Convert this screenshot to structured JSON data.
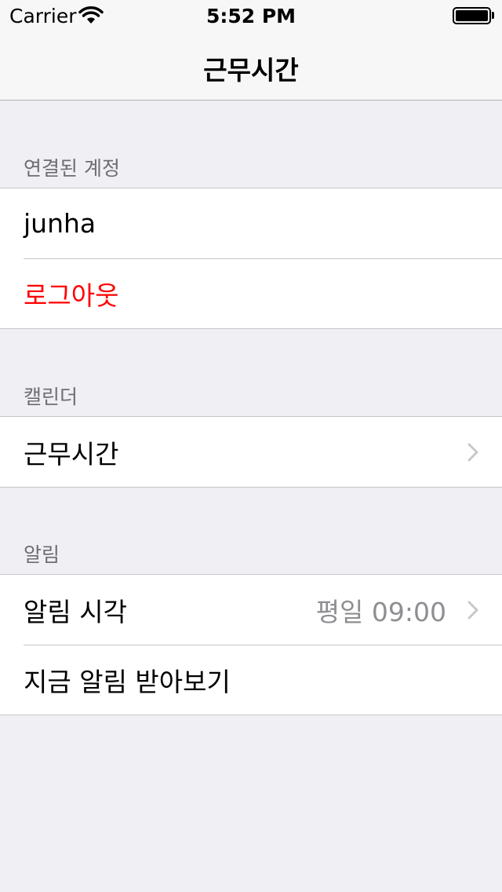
{
  "status_bar": {
    "carrier": "Carrier",
    "time": "5:52 PM"
  },
  "nav": {
    "title": "근무시간"
  },
  "sections": [
    {
      "header": "연결된 계정",
      "cells": [
        {
          "label": "junha"
        },
        {
          "label": "로그아웃",
          "color": "#ff0000"
        }
      ]
    },
    {
      "header": "캘린더",
      "cells": [
        {
          "label": "근무시간",
          "icon": "chevron-right-icon"
        }
      ]
    },
    {
      "header": "알림",
      "cells": [
        {
          "label": "알림 시각",
          "detail": "평일 09:00",
          "icon": "chevron-right-icon"
        },
        {
          "label": "지금 알림 받아보기"
        }
      ]
    }
  ],
  "colors": {
    "background": "#efeff4",
    "destructive": "#ff0000",
    "detail_text": "#8e8e93",
    "section_header": "#6d6d72"
  }
}
